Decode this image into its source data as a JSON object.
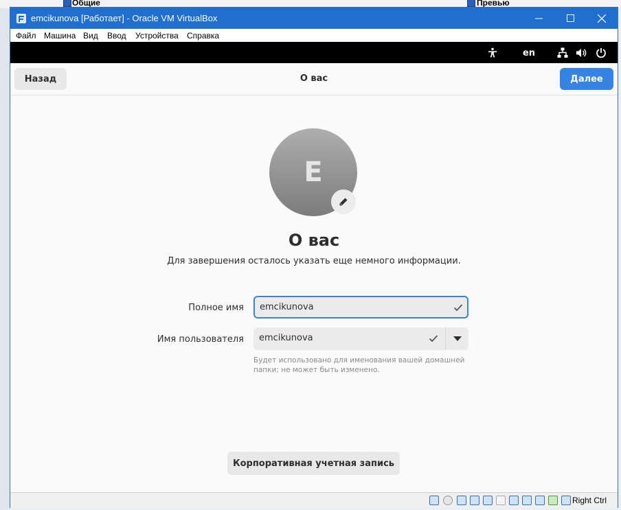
{
  "background": {
    "left_label": "Общие",
    "right_label": "Превью"
  },
  "window": {
    "title": "emcikunova [Работает] - Oracle VM VirtualBox",
    "controls": {
      "minimize": "—",
      "maximize": "☐",
      "close": "✕"
    },
    "menu": [
      "Файл",
      "Машина",
      "Вид",
      "Ввод",
      "Устройства",
      "Справка"
    ]
  },
  "guest_topbar": {
    "language": "en",
    "icons": [
      "accessibility-icon",
      "network-icon",
      "volume-icon",
      "power-icon"
    ]
  },
  "headerbar": {
    "back_label": "Назад",
    "title": "О вас",
    "next_label": "Далее"
  },
  "avatar": {
    "initial": "E"
  },
  "page": {
    "heading": "О вас",
    "subheading": "Для завершения осталось указать еще немного информации."
  },
  "form": {
    "fullname_label": "Полное имя",
    "fullname_value": "emcikunova",
    "username_label": "Имя пользователя",
    "username_value": "emcikunova",
    "username_hint": "Будет использовано для именования вашей домашней папки; не может быть изменено."
  },
  "enterprise_label": "Корпоративная учетная запись",
  "statusbar": {
    "host_key": "Right Ctrl"
  },
  "colors": {
    "titlebar": "#1f6fd0",
    "accent": "#3584e4",
    "topbar": "#000000"
  }
}
